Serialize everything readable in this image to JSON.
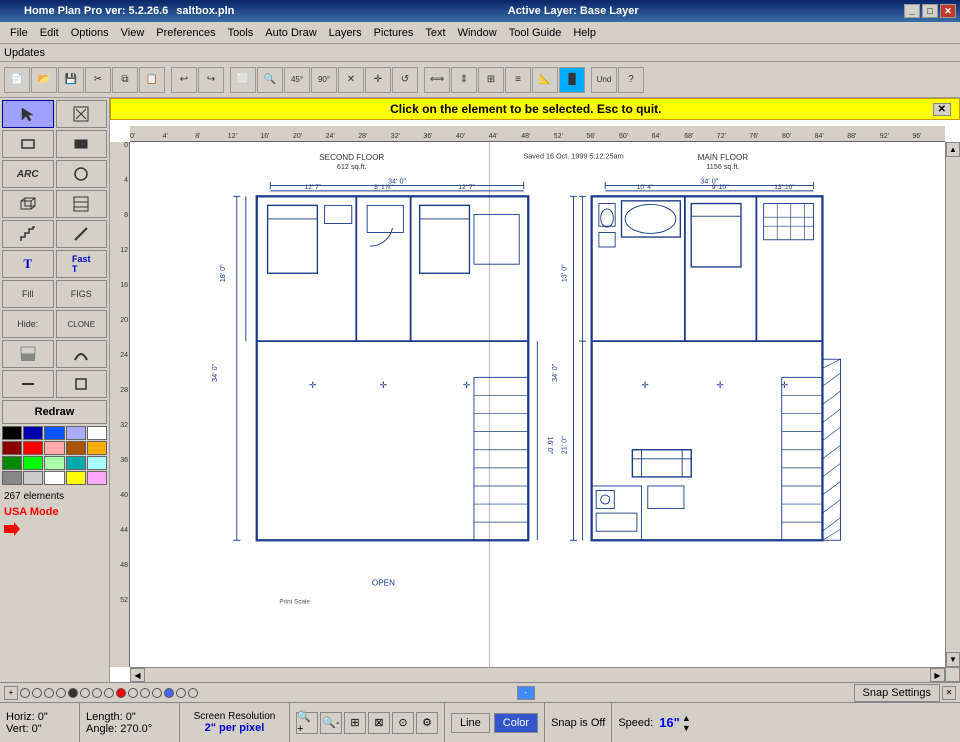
{
  "title": {
    "app": "Home Plan Pro ver: 5.2.26.6",
    "file": "saltbox.pln",
    "active_layer": "Active Layer: Base Layer"
  },
  "title_controls": {
    "minimize": "_",
    "maximize": "□",
    "close": "✕"
  },
  "menu": {
    "items": [
      {
        "label": "File",
        "id": "file"
      },
      {
        "label": "Edit",
        "id": "edit"
      },
      {
        "label": "Options",
        "id": "options"
      },
      {
        "label": "View",
        "id": "view"
      },
      {
        "label": "Preferences",
        "id": "preferences"
      },
      {
        "label": "Tools",
        "id": "tools"
      },
      {
        "label": "Auto Draw",
        "id": "autodraw"
      },
      {
        "label": "Layers",
        "id": "layers"
      },
      {
        "label": "Pictures",
        "id": "pictures"
      },
      {
        "label": "Text",
        "id": "text"
      },
      {
        "label": "Window",
        "id": "window"
      },
      {
        "label": "Tool Guide",
        "id": "toolguide"
      },
      {
        "label": "Help",
        "id": "help"
      }
    ],
    "updates": "Updates"
  },
  "hint": {
    "text": "Click on the element to be selected.  Esc to quit."
  },
  "left_toolbar": {
    "rows": [
      [
        "arrow",
        "magic"
      ],
      [
        "rect-outline",
        "rect-fill"
      ],
      [
        "arc",
        "circle"
      ],
      [
        "rect-3d",
        "wall"
      ],
      [
        "stair",
        "line"
      ],
      [
        "text",
        "text-fast"
      ],
      [
        "fill",
        "figs"
      ],
      [
        "hide",
        "clone"
      ],
      [
        "shade",
        "curve"
      ],
      [
        "line-h",
        "rect-sm"
      ]
    ],
    "redraw": "Redraw",
    "elements_count": "267 elements",
    "usa_mode": "USA Mode"
  },
  "colors": [
    "#000000",
    "#0000aa",
    "#0055ff",
    "#aaaaff",
    "#ffffff",
    "#880000",
    "#ff0000",
    "#ffaaaa",
    "#aa5500",
    "#ffaa00",
    "#008800",
    "#00ff00",
    "#aaffaa",
    "#00aaaa",
    "#aaffff",
    "#888888",
    "#cccccc",
    "#ffffff",
    "#ffff00",
    "#ffaaff"
  ],
  "ruler": {
    "h_marks": [
      "0'",
      "4'",
      "8'",
      "12'",
      "16'",
      "20'",
      "24'",
      "28'",
      "32'",
      "36'",
      "40'",
      "44'",
      "48'",
      "52'",
      "56'",
      "60'",
      "64'",
      "68'",
      "72'",
      "76'",
      "80'",
      "84'",
      "88'",
      "92'",
      "96'"
    ],
    "v_marks": [
      "0",
      "4",
      "8",
      "12",
      "16",
      "20",
      "24",
      "28",
      "32",
      "36",
      "40",
      "44",
      "48",
      "52"
    ]
  },
  "snap_bar": {
    "plus": "+",
    "minus": "-",
    "dots": [
      "empty",
      "empty",
      "empty",
      "empty",
      "filled",
      "empty",
      "empty",
      "empty",
      "red",
      "empty",
      "empty",
      "empty",
      "blue",
      "empty",
      "empty"
    ],
    "settings": "Snap Settings",
    "close": "✕"
  },
  "status": {
    "horiz": "Horiz: 0\"",
    "vert": "Vert: 0\"",
    "length": "Length: 0\"",
    "angle": "Angle: 270.0°",
    "screen_res_label": "Screen Resolution",
    "screen_res_value": "2\" per pixel",
    "line": "Line",
    "color": "Color",
    "snap_off": "Snap is Off",
    "speed_label": "Speed:",
    "speed_value": "16\""
  },
  "floor_plan": {
    "second_floor_label": "SECOND FLOOR",
    "second_floor_sqft": "612 sq.ft.",
    "main_floor_label": "MAIN FLOOR",
    "main_floor_sqft": "1156 sq.ft.",
    "saved_info": "Saved 16 Oct. 1999  5:12:25am",
    "open_label": "OPEN",
    "print_scale": "Print Scale"
  }
}
